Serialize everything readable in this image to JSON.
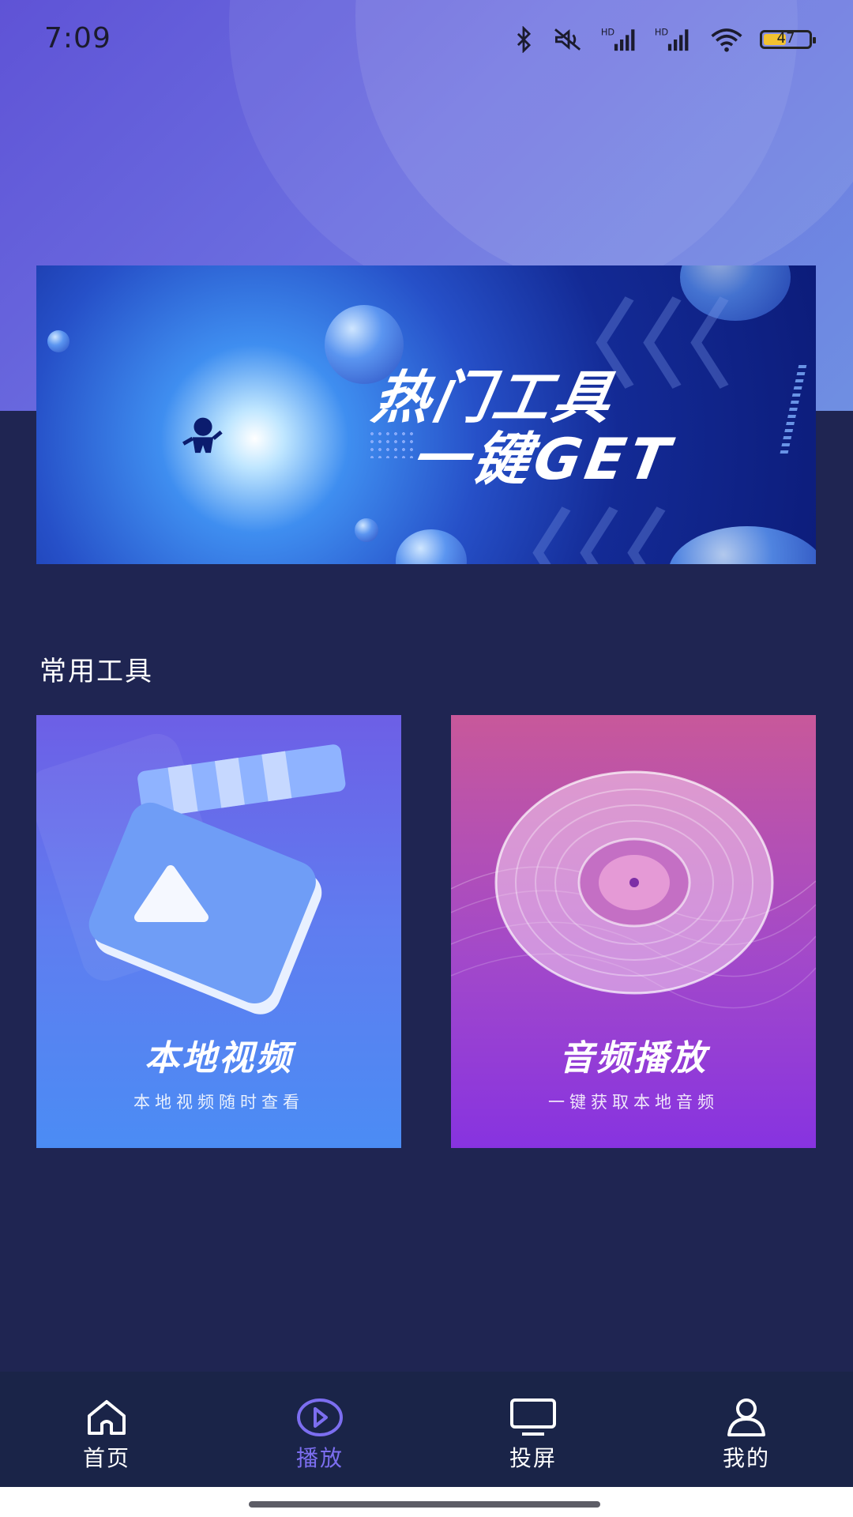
{
  "status_bar": {
    "time": "7:09",
    "battery_level": "47",
    "icons": [
      "bluetooth-icon",
      "mute-icon",
      "signal-hd-icon",
      "signal-hd-icon",
      "wifi-icon",
      "battery-icon"
    ]
  },
  "banner": {
    "title": "热门工具",
    "subtitle": "一键GET"
  },
  "section": {
    "title": "常用工具"
  },
  "tools": [
    {
      "title": "本地视频",
      "subtitle": "本地视频随时查看",
      "icon": "video-player-icon"
    },
    {
      "title": "音频播放",
      "subtitle": "一键获取本地音频",
      "icon": "vinyl-record-icon"
    }
  ],
  "nav": {
    "active": "播放",
    "items": [
      {
        "label": "首页",
        "icon": "home-icon"
      },
      {
        "label": "播放",
        "icon": "play-icon"
      },
      {
        "label": "投屏",
        "icon": "screen-cast-icon"
      },
      {
        "label": "我的",
        "icon": "user-icon"
      }
    ]
  },
  "colors": {
    "background": "#1f2552",
    "nav_background": "#1a2448",
    "nav_active": "#7c6ef0",
    "hero_gradient_start": "#5f53d6",
    "hero_gradient_end": "#6f8fe2"
  }
}
